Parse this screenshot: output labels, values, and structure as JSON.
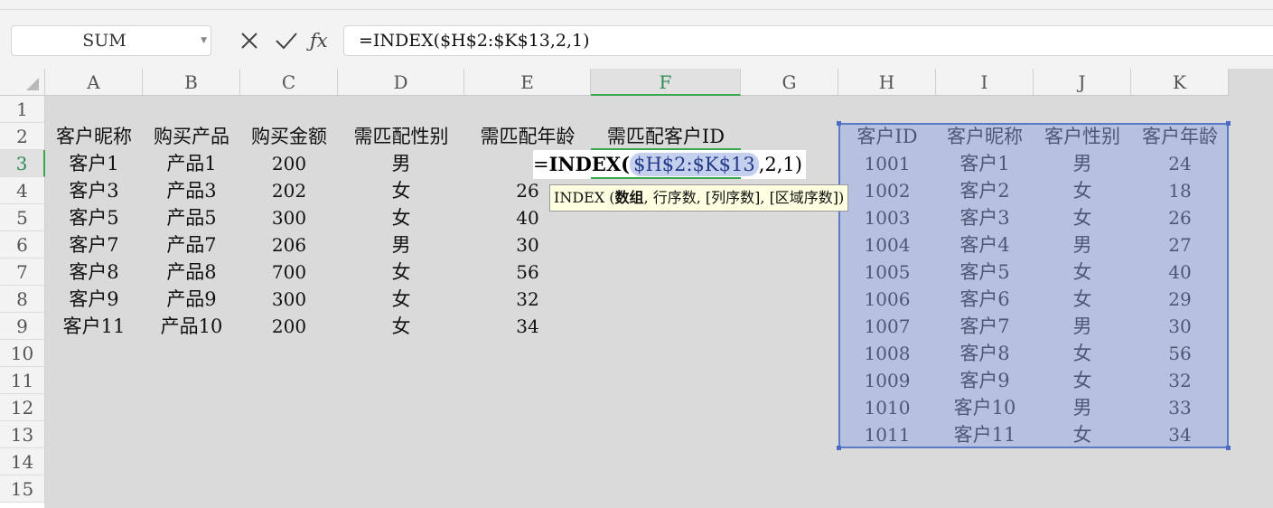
{
  "name_box": "SUM",
  "formula_bar": {
    "formula": "=INDEX($H$2:$K$13,2,1)"
  },
  "columns": [
    "A",
    "B",
    "C",
    "D",
    "E",
    "F",
    "G",
    "H",
    "I",
    "J",
    "K"
  ],
  "active_column": "F",
  "rows": [
    "1",
    "2",
    "3",
    "4",
    "5",
    "6",
    "7",
    "8",
    "9",
    "10",
    "11",
    "12",
    "13",
    "14",
    "15"
  ],
  "active_row": "3",
  "left_table": {
    "headers": [
      "客户昵称",
      "购买产品",
      "购买金额",
      "需匹配性别",
      "需匹配年龄",
      "需匹配客户ID"
    ],
    "rows": [
      [
        "客户1",
        "产品1",
        "200",
        "男",
        ""
      ],
      [
        "客户3",
        "产品3",
        "202",
        "女",
        "26"
      ],
      [
        "客户5",
        "产品5",
        "300",
        "女",
        "40"
      ],
      [
        "客户7",
        "产品7",
        "206",
        "男",
        "30"
      ],
      [
        "客户8",
        "产品8",
        "700",
        "女",
        "56"
      ],
      [
        "客户9",
        "产品9",
        "300",
        "女",
        "32"
      ],
      [
        "客户11",
        "产品10",
        "200",
        "女",
        "34"
      ]
    ]
  },
  "right_table": {
    "headers": [
      "客户ID",
      "客户昵称",
      "客户性别",
      "客户年龄"
    ],
    "rows": [
      [
        "1001",
        "客户1",
        "男",
        "24"
      ],
      [
        "1002",
        "客户2",
        "女",
        "18"
      ],
      [
        "1003",
        "客户3",
        "女",
        "26"
      ],
      [
        "1004",
        "客户4",
        "男",
        "27"
      ],
      [
        "1005",
        "客户5",
        "女",
        "40"
      ],
      [
        "1006",
        "客户6",
        "女",
        "29"
      ],
      [
        "1007",
        "客户7",
        "男",
        "30"
      ],
      [
        "1008",
        "客户8",
        "女",
        "56"
      ],
      [
        "1009",
        "客户9",
        "女",
        "32"
      ],
      [
        "1010",
        "客户10",
        "男",
        "33"
      ],
      [
        "1011",
        "客户11",
        "女",
        "34"
      ]
    ]
  },
  "edit_cell": {
    "prefix": "=",
    "fn": "INDEX(",
    "ref": "$H$2:$K$13",
    "rest": ",2,1)"
  },
  "tooltip": {
    "fn": "INDEX",
    "open": " (",
    "arg1": "数组",
    "rest": ", 行序数, [列序数], [区域序数])"
  }
}
